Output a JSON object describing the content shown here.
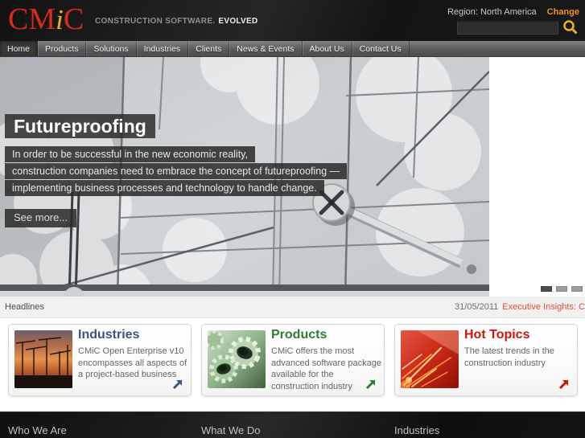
{
  "header": {
    "logo": {
      "cm": "CM",
      "i": "i",
      "c": "C"
    },
    "tagline_primary": "CONSTRUCTION SOFTWARE.",
    "tagline_secondary": "EVOLVED",
    "region_label": "Region: North America",
    "change_link": "Change",
    "search_value": ""
  },
  "nav": {
    "items": [
      {
        "label": "Home",
        "active": true
      },
      {
        "label": "Products",
        "active": false
      },
      {
        "label": "Solutions",
        "active": false
      },
      {
        "label": "Industries",
        "active": false
      },
      {
        "label": "Clients",
        "active": false
      },
      {
        "label": "News & Events",
        "active": false
      },
      {
        "label": "About Us",
        "active": false
      },
      {
        "label": "Contact Us",
        "active": false
      }
    ]
  },
  "hero": {
    "title": "Futureproofing",
    "line1": "In order to be successful in the new economic reality,",
    "line2": "construction companies need to embrace the concept of futureproofing —",
    "line3": "implementing business processes and technology to handle change.",
    "see_more": "See more..."
  },
  "carousel": {
    "dots": [
      {
        "active": true
      },
      {
        "active": false
      },
      {
        "active": false
      }
    ]
  },
  "headlines": {
    "label": "Headlines",
    "date": "31/05/2011",
    "headline": "Executive Insights: C"
  },
  "cards": [
    {
      "title": "Industries",
      "text": "CMiC Open Enterprise v10 encompasses all aspects of a project-based business",
      "accent_color": "#3d5480",
      "image": "construction-cranes-photo"
    },
    {
      "title": "Products",
      "text": "CMiC offers the most advanced software package available for the construction industry",
      "accent_color": "#2f7d33",
      "image": "green-gears-photo"
    },
    {
      "title": "Hot Topics",
      "text": "The latest trends in the construction industry",
      "accent_color": "#cc1607",
      "image": "red-sparks-photo"
    }
  ],
  "footer": {
    "columns": [
      {
        "title": "Who We Are"
      },
      {
        "title": "What We Do"
      },
      {
        "title": "Industries"
      }
    ]
  },
  "colors": {
    "logo_red": "#d42b1e",
    "logo_gold": "#eead1e",
    "accent_orange": "#f0941e",
    "headline_red": "#e8493a",
    "header_black": "#161616",
    "nav_gray": "#5a5a5a"
  }
}
